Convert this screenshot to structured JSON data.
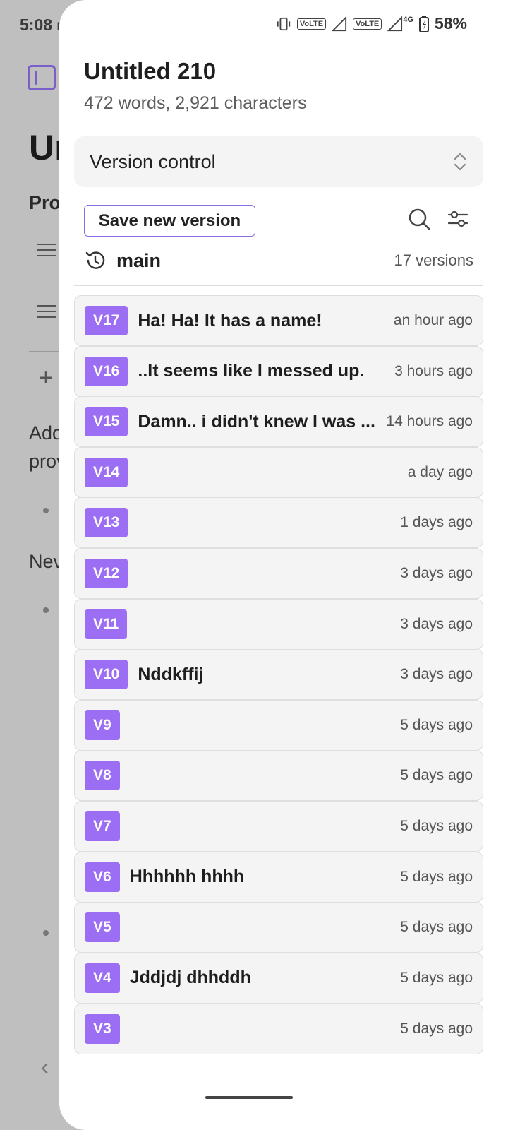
{
  "status_bar": {
    "time": "5:08",
    "ampm": "PM",
    "network": "4G",
    "volte1": "VoLTE",
    "volte2": "VoLTE",
    "battery": "58%"
  },
  "background_doc": {
    "title_fragment": "Un",
    "line1": "Pro",
    "add_text_1": "Add",
    "add_text_2": "prov",
    "new_text": "Nev"
  },
  "drawer": {
    "doc_title": "Untitled 210",
    "doc_stats": "472 words, 2,921 characters",
    "select_label": "Version control",
    "save_button": "Save new version",
    "branch_name": "main",
    "version_count": "17 versions",
    "icons": {
      "search": "search-icon",
      "filter": "sliders-icon",
      "history": "history-icon",
      "select": "chevron-updown-icon"
    }
  },
  "versions": [
    {
      "tag": "V17",
      "title": "Ha! Ha! It has a name!",
      "time": "an hour ago"
    },
    {
      "tag": "V16",
      "title": "..It seems like I messed up.",
      "time": "3 hours ago"
    },
    {
      "tag": "V15",
      "title": "Damn.. i didn't knew I was ...",
      "time": "14 hours ago"
    },
    {
      "tag": "V14",
      "title": "",
      "time": "a day ago"
    },
    {
      "tag": "V13",
      "title": "",
      "time": "1 days ago"
    },
    {
      "tag": "V12",
      "title": "",
      "time": "3 days ago"
    },
    {
      "tag": "V11",
      "title": "",
      "time": "3 days ago"
    },
    {
      "tag": "V10",
      "title": "Nddkffij",
      "time": "3 days ago"
    },
    {
      "tag": "V9",
      "title": "",
      "time": "5 days ago"
    },
    {
      "tag": "V8",
      "title": "",
      "time": "5 days ago"
    },
    {
      "tag": "V7",
      "title": "",
      "time": "5 days ago"
    },
    {
      "tag": "V6",
      "title": "Hhhhhh hhhh",
      "time": "5 days ago"
    },
    {
      "tag": "V5",
      "title": "",
      "time": "5 days ago"
    },
    {
      "tag": "V4",
      "title": "Jddjdj dhhddh",
      "time": "5 days ago"
    },
    {
      "tag": "V3",
      "title": "",
      "time": "5 days ago"
    }
  ],
  "colors": {
    "accent": "#9b6ef3",
    "button_border": "#8b6ee6"
  }
}
